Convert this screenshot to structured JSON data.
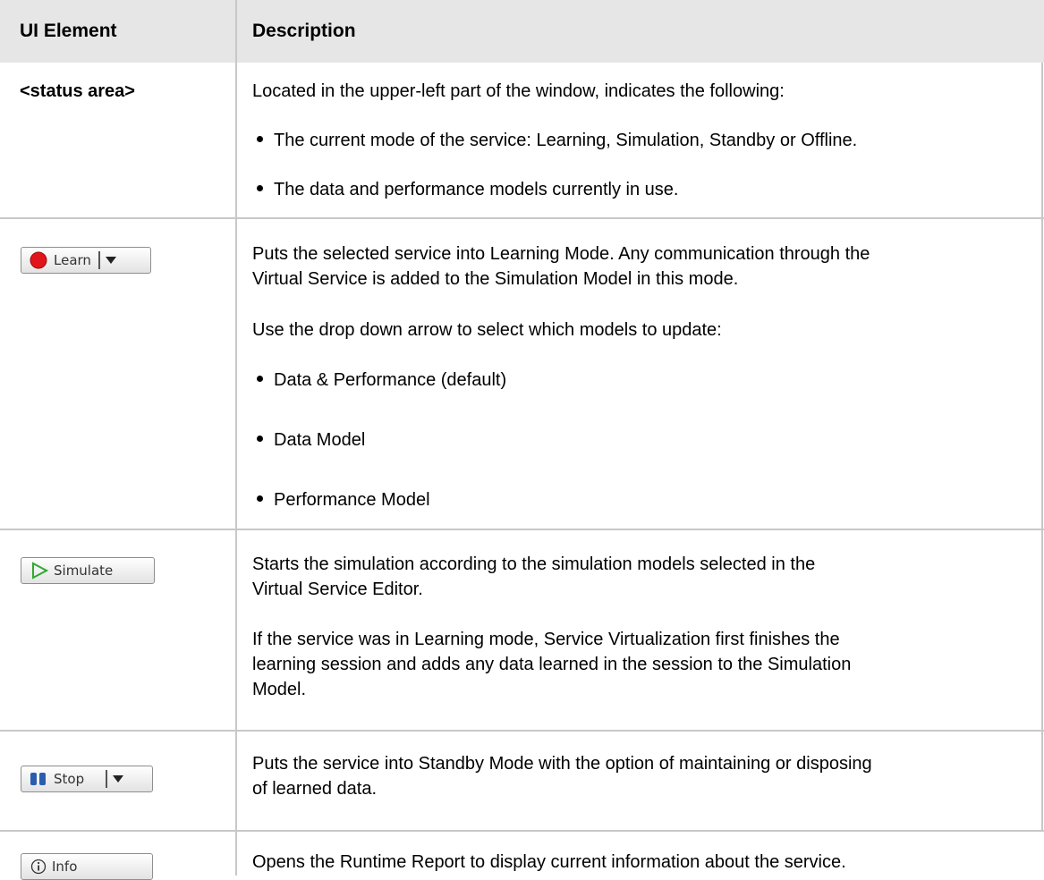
{
  "header": {
    "col1": "UI Element",
    "col2": "Description"
  },
  "rows": {
    "status": {
      "element": "<status area>",
      "desc": "Located in the upper-left part of the window, indicates the following:",
      "bullets": [
        "The current mode of the service: Learning, Simulation, Standby or Offline.",
        "The data and performance models currently in use."
      ]
    },
    "learn": {
      "button_label": "Learn",
      "desc_line1": "Puts the selected service into Learning Mode. Any communication through the",
      "desc_line2": "Virtual Service is added to the Simulation Model in this mode.",
      "desc2": "Use the drop down arrow to select which models to update:",
      "bullets": [
        "Data & Performance (default)",
        "Data Model",
        "Performance Model"
      ]
    },
    "simulate": {
      "button_label": "Simulate",
      "desc_line1": "Starts the simulation according to the simulation models selected in the",
      "desc_line2": "Virtual Service Editor.",
      "desc2_line1": "If the service was in Learning mode, Service Virtualization first finishes the",
      "desc2_line2": "learning session and adds any data learned in the session to the Simulation",
      "desc2_line3": "Model."
    },
    "stop": {
      "button_label": "Stop",
      "desc_line1": "Puts the service into Standby Mode with the option of maintaining or disposing",
      "desc_line2": "of learned data."
    },
    "info": {
      "button_label": "Info",
      "desc": "Opens the Runtime Report to display current information about the service."
    }
  },
  "colors": {
    "header_bg": "#e6e6e6",
    "grid": "#c8c8c8",
    "learn_dot": "#e0141a",
    "simulate_arrow": "#2eaa2e",
    "stop_icon": "#2a5db0"
  }
}
